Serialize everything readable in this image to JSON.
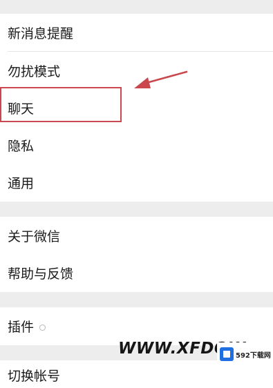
{
  "settings": {
    "items": [
      {
        "label": "新消息提醒"
      },
      {
        "label": "勿扰模式"
      },
      {
        "label": "聊天"
      },
      {
        "label": "隐私"
      },
      {
        "label": "通用"
      },
      {
        "label": "关于微信"
      },
      {
        "label": "帮助与反馈"
      },
      {
        "label": "插件"
      },
      {
        "label": "切换帐号"
      }
    ]
  },
  "annotation": {
    "color": "#c9474d"
  },
  "watermark": {
    "text": "WWW.XFDOW",
    "logo_text": "592下载网"
  }
}
